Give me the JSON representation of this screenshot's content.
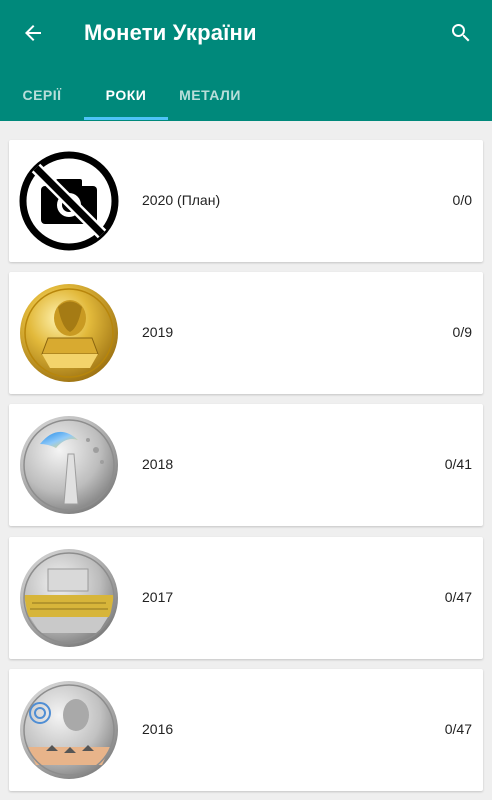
{
  "header": {
    "title": "Монети України",
    "back_icon": "arrow-back-icon",
    "search_icon": "search-icon",
    "color": "#00897b"
  },
  "tabs": [
    {
      "label": "СЕРІЇ",
      "active": false
    },
    {
      "label": "РОКИ",
      "active": true
    },
    {
      "label": "МЕТАЛИ",
      "active": false
    }
  ],
  "years": [
    {
      "year": "2020 (План)",
      "count": "0/0",
      "image": "no-photo-icon"
    },
    {
      "year": "2019",
      "count": "0/9",
      "image": "gold-coin-image"
    },
    {
      "year": "2018",
      "count": "0/41",
      "image": "silver-coin-image"
    },
    {
      "year": "2017",
      "count": "0/47",
      "image": "silver-gold-coin-image"
    },
    {
      "year": "2016",
      "count": "0/47",
      "image": "silver-color-coin-image"
    }
  ]
}
